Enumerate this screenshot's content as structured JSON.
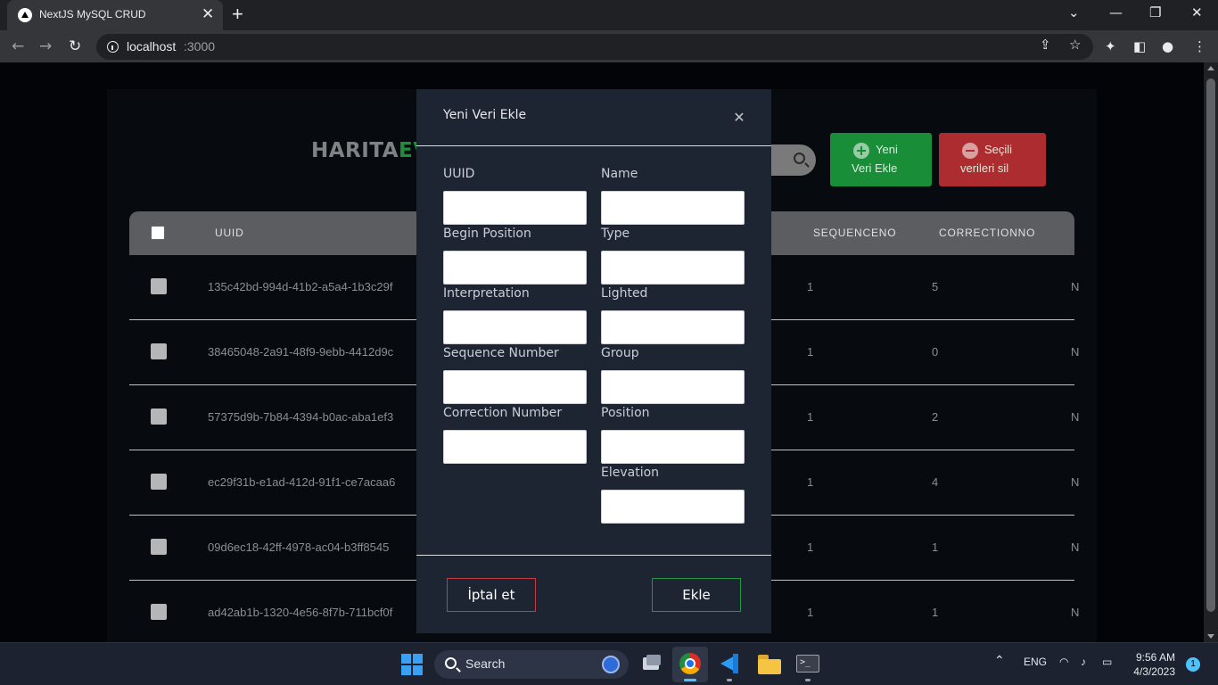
{
  "browser": {
    "tab_title": "NextJS MySQL CRUD",
    "tab_close": "✕",
    "new_tab": "+",
    "url_host": "localhost",
    "url_port": ":3000",
    "window_controls": {
      "minimize": "—",
      "restore": "❐",
      "close": "✕",
      "tab_search": "⌄"
    }
  },
  "app": {
    "logo_part1": "HARITA",
    "logo_part2": "EV",
    "add_button": {
      "line1": "Yeni",
      "line2": "Veri Ekle"
    },
    "delete_button": {
      "line1": "Seçili",
      "line2": "verileri sil"
    },
    "table": {
      "headers": {
        "uuid": "UUID",
        "sequenceno": "SEQUENCENO",
        "correctionno": "CORRECTIONNO"
      },
      "rows": [
        {
          "uuid": "135c42bd-994d-41b2-a5a4-1b3c29f",
          "seq": "1",
          "cor": "5",
          "more": "N"
        },
        {
          "uuid": "38465048-2a91-48f9-9ebb-4412d9c",
          "seq": "1",
          "cor": "0",
          "more": "N"
        },
        {
          "uuid": "57375d9b-7b84-4394-b0ac-aba1ef3",
          "seq": "1",
          "cor": "2",
          "more": "N"
        },
        {
          "uuid": "ec29f31b-e1ad-412d-91f1-ce7acaa6",
          "seq": "1",
          "cor": "4",
          "more": "N"
        },
        {
          "uuid": "09d6ec18-42ff-4978-ac04-b3ff8545",
          "seq": "1",
          "cor": "1",
          "more": "N"
        },
        {
          "uuid": "ad42ab1b-1320-4e56-8f7b-711bcf0f",
          "seq": "1",
          "cor": "1",
          "more": "N"
        }
      ]
    }
  },
  "modal": {
    "title": "Yeni Veri Ekle",
    "close": "✕",
    "fields": {
      "uuid": "UUID",
      "name": "Name",
      "begin_position": "Begin Position",
      "type": "Type",
      "interpretation": "Interpretation",
      "lighted": "Lighted",
      "sequence_number": "Sequence Number",
      "group": "Group",
      "correction_number": "Correction Number",
      "position": "Position",
      "elevation": "Elevation"
    },
    "cancel_label": "İptal et",
    "submit_label": "Ekle"
  },
  "taskbar": {
    "search_label": "Search",
    "lang": "ENG",
    "time": "9:56 AM",
    "date": "4/3/2023",
    "notification_count": "1"
  },
  "colors": {
    "page_bg": "#030407",
    "modal_bg": "#1e2532",
    "add_green": "#1a8d39",
    "delete_red": "#ad2c2f",
    "taskbar_bg": "#1c2230"
  }
}
